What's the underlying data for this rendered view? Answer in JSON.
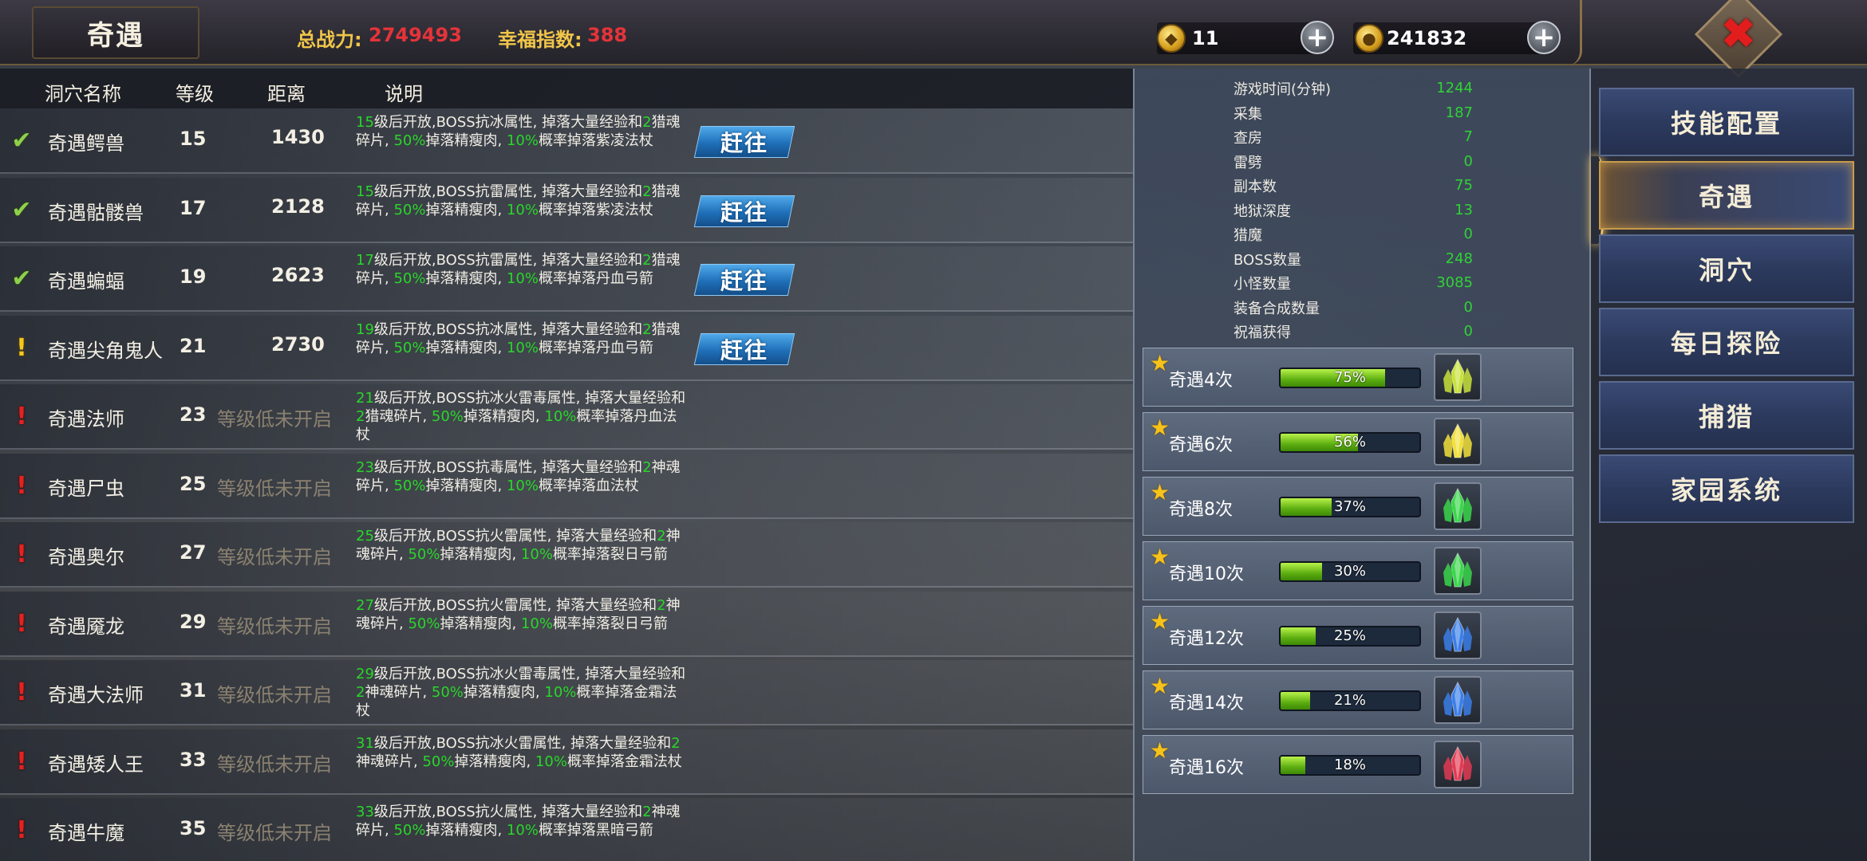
{
  "header": {
    "title": "奇遇",
    "power_label": "总战力:",
    "power_value": "2749493",
    "happiness_label": "幸福指数:",
    "happiness_value": "388",
    "gold_ingot": "11",
    "coins": "241832"
  },
  "table": {
    "columns": [
      "洞穴名称",
      "等级",
      "距离",
      "说明"
    ],
    "go_label": "赶往",
    "locked_label": "等级低未开启",
    "rows": [
      {
        "status": "check",
        "name": "奇遇鳄兽",
        "level": "15",
        "distance": "1430",
        "desc": [
          [
            "g",
            "15"
          ],
          [
            "t",
            "级后开放,BOSS抗冰属性, 掉落大量经验和"
          ],
          [
            "g",
            "2"
          ],
          [
            "t",
            "猎魂碎片, "
          ],
          [
            "g",
            "50%"
          ],
          [
            "t",
            "掉落精瘦肉, "
          ],
          [
            "g",
            "10%"
          ],
          [
            "t",
            "概率掉落紫凌法杖"
          ]
        ]
      },
      {
        "status": "check",
        "name": "奇遇骷髅兽",
        "level": "17",
        "distance": "2128",
        "desc": [
          [
            "g",
            "15"
          ],
          [
            "t",
            "级后开放,BOSS抗雷属性, 掉落大量经验和"
          ],
          [
            "g",
            "2"
          ],
          [
            "t",
            "猎魂碎片, "
          ],
          [
            "g",
            "50%"
          ],
          [
            "t",
            "掉落精瘦肉, "
          ],
          [
            "g",
            "10%"
          ],
          [
            "t",
            "概率掉落紫凌法杖"
          ]
        ]
      },
      {
        "status": "check",
        "name": "奇遇蝙蝠",
        "level": "19",
        "distance": "2623",
        "desc": [
          [
            "g",
            "17"
          ],
          [
            "t",
            "级后开放,BOSS抗雷属性, 掉落大量经验和"
          ],
          [
            "g",
            "2"
          ],
          [
            "t",
            "猎魂碎片, "
          ],
          [
            "g",
            "50%"
          ],
          [
            "t",
            "掉落精瘦肉, "
          ],
          [
            "g",
            "10%"
          ],
          [
            "t",
            "概率掉落丹血弓箭"
          ]
        ]
      },
      {
        "status": "warn",
        "name": "奇遇尖角鬼人",
        "level": "21",
        "distance": "2730",
        "desc": [
          [
            "g",
            "19"
          ],
          [
            "t",
            "级后开放,BOSS抗冰属性, 掉落大量经验和"
          ],
          [
            "g",
            "2"
          ],
          [
            "t",
            "猎魂碎片, "
          ],
          [
            "g",
            "50%"
          ],
          [
            "t",
            "掉落精瘦肉, "
          ],
          [
            "g",
            "10%"
          ],
          [
            "t",
            "概率掉落丹血弓箭"
          ]
        ]
      },
      {
        "status": "locked",
        "name": "奇遇法师",
        "level": "23",
        "desc": [
          [
            "g",
            "21"
          ],
          [
            "t",
            "级后开放,BOSS抗冰火雷毒属性, 掉落大量经验和"
          ],
          [
            "g",
            "2"
          ],
          [
            "t",
            "猎魂碎片, "
          ],
          [
            "g",
            "50%"
          ],
          [
            "t",
            "掉落精瘦肉, "
          ],
          [
            "g",
            "10%"
          ],
          [
            "t",
            "概率掉落丹血法杖"
          ]
        ]
      },
      {
        "status": "locked",
        "name": "奇遇尸虫",
        "level": "25",
        "desc": [
          [
            "g",
            "23"
          ],
          [
            "t",
            "级后开放,BOSS抗毒属性, 掉落大量经验和"
          ],
          [
            "g",
            "2"
          ],
          [
            "t",
            "神魂碎片, "
          ],
          [
            "g",
            "50%"
          ],
          [
            "t",
            "掉落精瘦肉, "
          ],
          [
            "g",
            "10%"
          ],
          [
            "t",
            "概率掉落血法杖"
          ]
        ]
      },
      {
        "status": "locked",
        "name": "奇遇奥尔",
        "level": "27",
        "desc": [
          [
            "g",
            "25"
          ],
          [
            "t",
            "级后开放,BOSS抗火雷属性, 掉落大量经验和"
          ],
          [
            "g",
            "2"
          ],
          [
            "t",
            "神魂碎片, "
          ],
          [
            "g",
            "50%"
          ],
          [
            "t",
            "掉落精瘦肉, "
          ],
          [
            "g",
            "10%"
          ],
          [
            "t",
            "概率掉落裂日弓箭"
          ]
        ]
      },
      {
        "status": "locked",
        "name": "奇遇魇龙",
        "level": "29",
        "desc": [
          [
            "g",
            "27"
          ],
          [
            "t",
            "级后开放,BOSS抗火雷属性, 掉落大量经验和"
          ],
          [
            "g",
            "2"
          ],
          [
            "t",
            "神魂碎片, "
          ],
          [
            "g",
            "50%"
          ],
          [
            "t",
            "掉落精瘦肉, "
          ],
          [
            "g",
            "10%"
          ],
          [
            "t",
            "概率掉落裂日弓箭"
          ]
        ]
      },
      {
        "status": "locked",
        "name": "奇遇大法师",
        "level": "31",
        "desc": [
          [
            "g",
            "29"
          ],
          [
            "t",
            "级后开放,BOSS抗冰火雷毒属性, 掉落大量经验和"
          ],
          [
            "g",
            "2"
          ],
          [
            "t",
            "神魂碎片, "
          ],
          [
            "g",
            "50%"
          ],
          [
            "t",
            "掉落精瘦肉, "
          ],
          [
            "g",
            "10%"
          ],
          [
            "t",
            "概率掉落金霜法杖"
          ]
        ]
      },
      {
        "status": "locked",
        "name": "奇遇矮人王",
        "level": "33",
        "desc": [
          [
            "g",
            "31"
          ],
          [
            "t",
            "级后开放,BOSS抗冰火雷属性, 掉落大量经验和"
          ],
          [
            "g",
            "2"
          ],
          [
            "t",
            "神魂碎片, "
          ],
          [
            "g",
            "50%"
          ],
          [
            "t",
            "掉落精瘦肉, "
          ],
          [
            "g",
            "10%"
          ],
          [
            "t",
            "概率掉落金霜法杖"
          ]
        ]
      },
      {
        "status": "locked",
        "name": "奇遇牛魔",
        "level": "35",
        "desc": [
          [
            "g",
            "33"
          ],
          [
            "t",
            "级后开放,BOSS抗火属性, 掉落大量经验和"
          ],
          [
            "g",
            "2"
          ],
          [
            "t",
            "神魂碎片, "
          ],
          [
            "g",
            "50%"
          ],
          [
            "t",
            "掉落精瘦肉, "
          ],
          [
            "g",
            "10%"
          ],
          [
            "t",
            "概率掉落黑暗弓箭"
          ]
        ]
      }
    ]
  },
  "stats": [
    {
      "label": "游戏时间(分钟)",
      "value": "1244"
    },
    {
      "label": "采集",
      "value": "187"
    },
    {
      "label": "查房",
      "value": "7"
    },
    {
      "label": "雷劈",
      "value": "0"
    },
    {
      "label": "副本数",
      "value": "75"
    },
    {
      "label": "地狱深度",
      "value": "13"
    },
    {
      "label": "猎魔",
      "value": "0"
    },
    {
      "label": "BOSS数量",
      "value": "248"
    },
    {
      "label": "小怪数量",
      "value": "3085"
    },
    {
      "label": "装备合成数量",
      "value": "0"
    },
    {
      "label": "祝福获得",
      "value": "0"
    }
  ],
  "encounters": [
    {
      "label": "奇遇4次",
      "percent": 75,
      "percent_text": "75%",
      "gem": "yellow-green"
    },
    {
      "label": "奇遇6次",
      "percent": 56,
      "percent_text": "56%",
      "gem": "yellow"
    },
    {
      "label": "奇遇8次",
      "percent": 37,
      "percent_text": "37%",
      "gem": "green"
    },
    {
      "label": "奇遇10次",
      "percent": 30,
      "percent_text": "30%",
      "gem": "green"
    },
    {
      "label": "奇遇12次",
      "percent": 25,
      "percent_text": "25%",
      "gem": "blue"
    },
    {
      "label": "奇遇14次",
      "percent": 21,
      "percent_text": "21%",
      "gem": "blue"
    },
    {
      "label": "奇遇16次",
      "percent": 18,
      "percent_text": "18%",
      "gem": "red"
    }
  ],
  "gem_colors": {
    "yellow-green": "#c8e23a",
    "yellow": "#f2e03a",
    "green": "#39d64a",
    "blue": "#3a7ee8",
    "red": "#e23a52"
  },
  "menu": [
    {
      "label": "技能配置",
      "active": false
    },
    {
      "label": "奇遇",
      "active": true
    },
    {
      "label": "洞穴",
      "active": false
    },
    {
      "label": "每日探险",
      "active": false
    },
    {
      "label": "捕猎",
      "active": false
    },
    {
      "label": "家园系统",
      "active": false
    }
  ]
}
